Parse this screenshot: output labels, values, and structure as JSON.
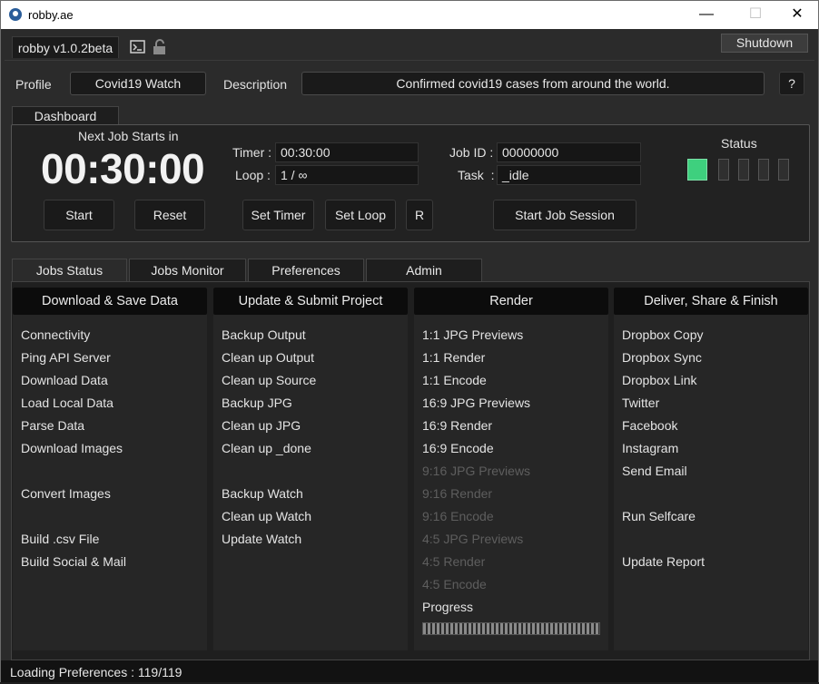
{
  "window": {
    "title": "robby.ae",
    "min_symbol": "—",
    "max_symbol": "☐",
    "close_symbol": "✕"
  },
  "header": {
    "version_tab": "robby v1.0.2beta",
    "shutdown_label": "Shutdown",
    "icons": [
      "terminal-icon",
      "unlock-icon"
    ]
  },
  "profile": {
    "profile_label": "Profile",
    "profile_value": "Covid19 Watch",
    "description_label": "Description",
    "description_value": "Confirmed covid19 cases from around the world.",
    "help_label": "?"
  },
  "dashboard": {
    "tab_label": "Dashboard",
    "next_job_label": "Next Job Starts in",
    "countdown": "00:30:00",
    "timer_label": "Timer :",
    "timer_value": "00:30:00",
    "loop_label": "Loop :",
    "loop_value": "1 / ∞",
    "job_id_label": "Job ID :",
    "job_id_value": "00000000",
    "task_label": "Task  :",
    "task_value": "_idle",
    "status_label": "Status",
    "status_leds": [
      true,
      false,
      false,
      false,
      false
    ],
    "buttons": {
      "start": "Start",
      "reset": "Reset",
      "set_timer": "Set Timer",
      "set_loop": "Set Loop",
      "r": "R",
      "start_job_session": "Start Job Session"
    },
    "status_color": "#3ed07e"
  },
  "tabs": [
    {
      "label": "Jobs Status",
      "active": true
    },
    {
      "label": "Jobs Monitor",
      "active": false
    },
    {
      "label": "Preferences",
      "active": false
    },
    {
      "label": "Admin",
      "active": false
    }
  ],
  "columns": [
    {
      "header": "Download & Save Data",
      "items": [
        {
          "label": "Connectivity",
          "row": 0,
          "dim": false
        },
        {
          "label": "Ping API Server",
          "row": 1,
          "dim": false
        },
        {
          "label": "Download Data",
          "row": 2,
          "dim": false
        },
        {
          "label": "Load Local Data",
          "row": 3,
          "dim": false
        },
        {
          "label": "Parse Data",
          "row": 4,
          "dim": false
        },
        {
          "label": "Download Images",
          "row": 5,
          "dim": false
        },
        {
          "label": "Convert Images",
          "row": 7,
          "dim": false
        },
        {
          "label": "Build .csv File",
          "row": 9,
          "dim": false
        },
        {
          "label": "Build Social & Mail",
          "row": 10,
          "dim": false
        }
      ]
    },
    {
      "header": "Update & Submit Project",
      "items": [
        {
          "label": "Backup Output",
          "row": 0,
          "dim": false
        },
        {
          "label": "Clean up Output",
          "row": 1,
          "dim": false
        },
        {
          "label": "Clean up Source",
          "row": 2,
          "dim": false
        },
        {
          "label": "Backup JPG",
          "row": 3,
          "dim": false
        },
        {
          "label": "Clean up JPG",
          "row": 4,
          "dim": false
        },
        {
          "label": "Clean up _done",
          "row": 5,
          "dim": false
        },
        {
          "label": "Backup Watch",
          "row": 7,
          "dim": false
        },
        {
          "label": "Clean up Watch",
          "row": 8,
          "dim": false
        },
        {
          "label": "Update Watch",
          "row": 9,
          "dim": false
        }
      ]
    },
    {
      "header": "Render",
      "items": [
        {
          "label": "1:1 JPG Previews",
          "row": 0,
          "dim": false
        },
        {
          "label": "1:1 Render",
          "row": 1,
          "dim": false
        },
        {
          "label": "1:1 Encode",
          "row": 2,
          "dim": false
        },
        {
          "label": "16:9 JPG Previews",
          "row": 3,
          "dim": false
        },
        {
          "label": "16:9 Render",
          "row": 4,
          "dim": false
        },
        {
          "label": "16:9 Encode",
          "row": 5,
          "dim": false
        },
        {
          "label": "9:16 JPG Previews",
          "row": 6,
          "dim": true
        },
        {
          "label": "9:16 Render",
          "row": 7,
          "dim": true
        },
        {
          "label": "9:16 Encode",
          "row": 8,
          "dim": true
        },
        {
          "label": "4:5 JPG Previews",
          "row": 9,
          "dim": true
        },
        {
          "label": "4:5 Render",
          "row": 10,
          "dim": true
        },
        {
          "label": "4:5 Encode",
          "row": 11,
          "dim": true
        },
        {
          "label": "Progress",
          "row": 12,
          "dim": false
        }
      ],
      "progress": 0
    },
    {
      "header": "Deliver, Share & Finish",
      "items": [
        {
          "label": "Dropbox Copy",
          "row": 0,
          "dim": false
        },
        {
          "label": "Dropbox Sync",
          "row": 1,
          "dim": false
        },
        {
          "label": "Dropbox Link",
          "row": 2,
          "dim": false
        },
        {
          "label": "Twitter",
          "row": 3,
          "dim": false
        },
        {
          "label": "Facebook",
          "row": 4,
          "dim": false
        },
        {
          "label": "Instagram",
          "row": 5,
          "dim": false
        },
        {
          "label": "Send Email",
          "row": 6,
          "dim": false
        },
        {
          "label": "Run Selfcare",
          "row": 8,
          "dim": false
        },
        {
          "label": "Update Report",
          "row": 10,
          "dim": false
        }
      ]
    }
  ],
  "statusbar": {
    "text": "Loading Preferences : 119/119"
  }
}
